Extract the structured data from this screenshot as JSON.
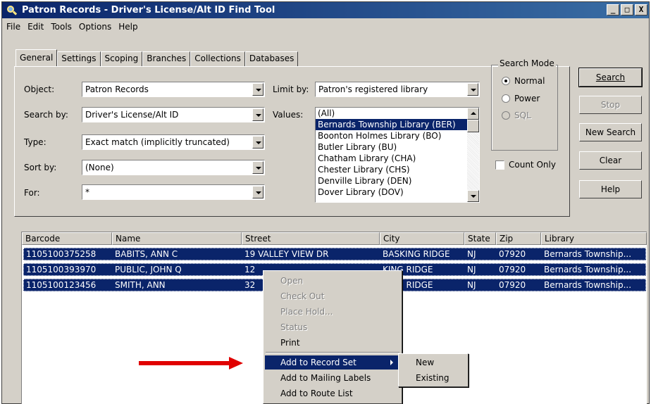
{
  "window": {
    "title": "Patron Records - Driver's License/Alt ID Find Tool",
    "controls": {
      "minimize": "_",
      "maximize": "□",
      "close": "X"
    }
  },
  "menu": [
    "File",
    "Edit",
    "Tools",
    "Options",
    "Help"
  ],
  "tabs": [
    "General",
    "Settings",
    "Scoping",
    "Branches",
    "Collections",
    "Databases"
  ],
  "form": {
    "object_label": "Object:",
    "object_value": "Patron Records",
    "search_by_label": "Search by:",
    "search_by_value": "Driver's License/Alt ID",
    "type_label": "Type:",
    "type_value": "Exact match (implicitly truncated)",
    "sort_by_label": "Sort by:",
    "sort_by_value": "(None)",
    "for_label": "For:",
    "for_value": "*",
    "limit_by_label": "Limit by:",
    "limit_by_value": "Patron's registered library",
    "values_label": "Values:",
    "values": [
      "(All)",
      "Bernards Township Library (BER)",
      "Boonton Holmes Library (BO)",
      "Butler Library (BU)",
      "Chatham Library (CHA)",
      "Chester Library (CHS)",
      "Denville Library (DEN)",
      "Dover Library (DOV)"
    ],
    "selected_value_index": 1
  },
  "search_mode": {
    "title": "Search Mode",
    "options": [
      "Normal",
      "Power",
      "SQL"
    ],
    "selected": "Normal",
    "count_only_label": "Count Only"
  },
  "buttons": {
    "search": "Search",
    "stop": "Stop",
    "new_search": "New Search",
    "clear": "Clear",
    "help": "Help"
  },
  "results": {
    "columns": [
      "Barcode",
      "Name",
      "Street",
      "City",
      "State",
      "Zip",
      "Library"
    ],
    "rows": [
      [
        "1105100375258",
        "BABITS, ANN C",
        "19 VALLEY VIEW DR",
        "BASKING RIDGE",
        "NJ",
        "07920",
        "Bernards Township..."
      ],
      [
        "1105100393970",
        "PUBLIC, JOHN Q",
        "12",
        "KING RIDGE",
        "NJ",
        "07920",
        "Bernards Township..."
      ],
      [
        "1105100123456",
        "SMITH, ANN",
        "32",
        "KING RIDGE",
        "NJ",
        "07920",
        "Bernards Township..."
      ]
    ]
  },
  "context_menu": {
    "items": [
      "Open",
      "Check Out",
      "Place Hold...",
      "Status",
      "Print",
      "Add to Record Set",
      "Add to Mailing Labels",
      "Add to Route List"
    ],
    "disabled": [
      "Open",
      "Check Out",
      "Place Hold...",
      "Status"
    ],
    "highlighted": "Add to Record Set"
  },
  "submenu": {
    "items": [
      "New",
      "Existing"
    ]
  },
  "colors": {
    "selection": "#0a246a",
    "arrow": "#e00000",
    "face": "#d4d0c8"
  }
}
